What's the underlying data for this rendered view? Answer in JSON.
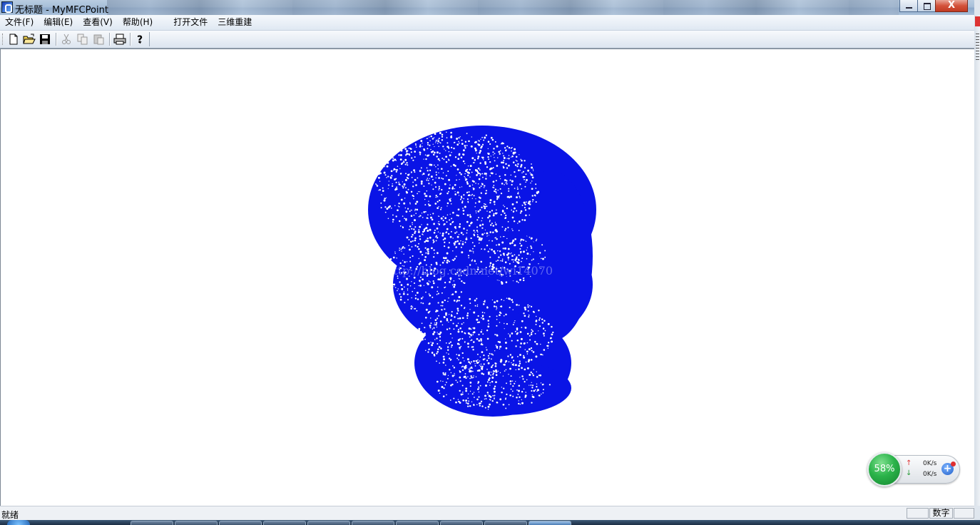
{
  "window": {
    "title": "无标题 - MyMFCPoint",
    "close_glyph": "X"
  },
  "menu": [
    {
      "label": "文件(F)"
    },
    {
      "label": "编辑(E)"
    },
    {
      "label": "查看(V)"
    },
    {
      "label": "帮助(H)"
    },
    {
      "label": "打开文件"
    },
    {
      "label": "三维重建"
    }
  ],
  "toolbar": {
    "buttons": [
      {
        "name": "new-file-icon",
        "enabled": true
      },
      {
        "name": "open-folder-icon",
        "enabled": true
      },
      {
        "name": "save-icon",
        "enabled": true
      },
      {
        "name": "cut-icon",
        "enabled": false
      },
      {
        "name": "copy-icon",
        "enabled": false
      },
      {
        "name": "paste-icon",
        "enabled": false
      },
      {
        "name": "print-icon",
        "enabled": true
      },
      {
        "name": "help-icon",
        "enabled": true
      }
    ]
  },
  "canvas": {
    "background": "#ffffff",
    "point_color": "#0a14e6",
    "watermark": "http://blog.csdn.net/wi14070"
  },
  "net_widget": {
    "percent": "58%",
    "up_arrow": "↑",
    "down_arrow": "↓",
    "up_rate": "0K/s",
    "down_rate": "0K/s",
    "plus": "+"
  },
  "status": {
    "text": "就绪",
    "panes": [
      "",
      "数字",
      ""
    ]
  }
}
